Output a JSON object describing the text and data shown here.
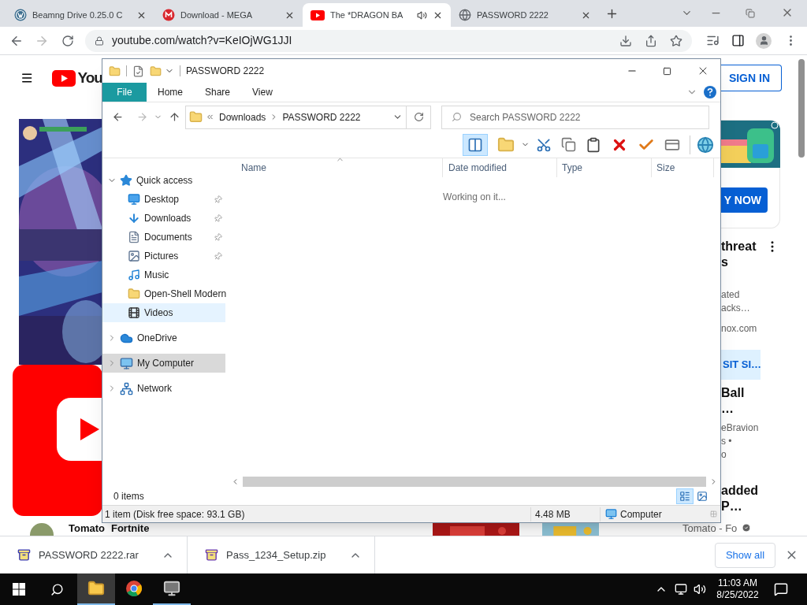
{
  "browser": {
    "tabs": [
      {
        "title": "Beamng Drive 0.25.0 C",
        "kind": "wordpress",
        "selected": false,
        "playing_audio": false
      },
      {
        "title": "Download - MEGA",
        "kind": "mega",
        "selected": false,
        "playing_audio": false
      },
      {
        "title": "The *DRAGON BA",
        "kind": "video",
        "selected": true,
        "playing_audio": true
      },
      {
        "title": "PASSWORD 2222",
        "kind": "globe",
        "selected": false,
        "playing_audio": false
      }
    ],
    "address": "youtube.com/watch?v=KeIOjWG1JJI"
  },
  "youtube": {
    "logo_text": "You",
    "sign_in": "SIGN IN",
    "ad_button": "Y NOW",
    "recommendations": [
      {
        "title_lines": [
          "threat",
          "s"
        ],
        "meta_lines": [
          "ated",
          "acks…",
          "nox.com"
        ],
        "action": "SIT SI…"
      },
      {
        "title_lines": [
          "Ball",
          "…"
        ],
        "meta_lines": [
          "eBravion",
          "s •",
          "o"
        ]
      },
      {
        "title_lines": [
          "added",
          "P…"
        ]
      }
    ],
    "bottom_row": {
      "channel": "Tomato",
      "game": "Fortnite",
      "channel_2": "Tomato - Fo"
    }
  },
  "explorer": {
    "title": "PASSWORD 2222",
    "ribbon_tabs": [
      {
        "label": "File",
        "kind": "file"
      },
      {
        "label": "Home",
        "kind": "tab"
      },
      {
        "label": "Share",
        "kind": "tab"
      },
      {
        "label": "View",
        "kind": "tab"
      }
    ],
    "path": [
      "Downloads",
      "PASSWORD 2222"
    ],
    "search_placeholder": "Search PASSWORD 2222",
    "preview_pane_on": true,
    "columns": [
      {
        "label": "Name",
        "sorted": true
      },
      {
        "label": "Date modified",
        "sorted": false
      },
      {
        "label": "Type",
        "sorted": false
      },
      {
        "label": "Size",
        "sorted": false
      }
    ],
    "status_message": "Working on it...",
    "nav": [
      {
        "label": "Quick access",
        "kind": "star",
        "expanded": true,
        "selected": false,
        "hovered": false,
        "children": [
          {
            "label": "Desktop",
            "kind": "desktop",
            "pinned": true,
            "selected": false,
            "hovered": false
          },
          {
            "label": "Downloads",
            "kind": "download",
            "pinned": true,
            "selected": false,
            "hovered": false
          },
          {
            "label": "Documents",
            "kind": "document",
            "pinned": true,
            "selected": false,
            "hovered": false
          },
          {
            "label": "Pictures",
            "kind": "picture",
            "pinned": true,
            "selected": false,
            "hovered": false
          },
          {
            "label": "Music",
            "kind": "music",
            "pinned": false,
            "selected": false,
            "hovered": false
          },
          {
            "label": "Open-Shell Modern",
            "kind": "folder",
            "pinned": false,
            "selected": false,
            "hovered": false
          },
          {
            "label": "Videos",
            "kind": "video",
            "pinned": false,
            "selected": false,
            "hovered": true
          }
        ]
      },
      {
        "label": "OneDrive",
        "kind": "cloud",
        "expanded": false,
        "selected": false,
        "hovered": false
      },
      {
        "label": "My Computer",
        "kind": "computer",
        "expanded": false,
        "selected": true,
        "hovered": false
      },
      {
        "label": "Network",
        "kind": "network",
        "expanded": false,
        "selected": false,
        "hovered": false
      }
    ],
    "item_count": "0 items",
    "view_buttons": [
      {
        "kind": "details",
        "selected": true
      },
      {
        "kind": "large",
        "selected": false
      }
    ],
    "status": {
      "details": "1 item (Disk free space: 93.1 GB)",
      "size": "4.48 MB",
      "location": "Computer"
    }
  },
  "downloads": {
    "items": [
      {
        "name": "PASSWORD 2222.rar",
        "kind": "rar"
      },
      {
        "name": "Pass_1234_Setup.zip",
        "kind": "zip"
      }
    ],
    "show_all": "Show all"
  },
  "taskbar": {
    "apps": [
      {
        "kind": "explorer",
        "active": true,
        "running": true
      },
      {
        "kind": "chrome",
        "active": false,
        "running": false
      },
      {
        "kind": "monitor",
        "active": false,
        "running": true
      }
    ],
    "time": "11:03 AM",
    "date": "8/25/2022"
  }
}
